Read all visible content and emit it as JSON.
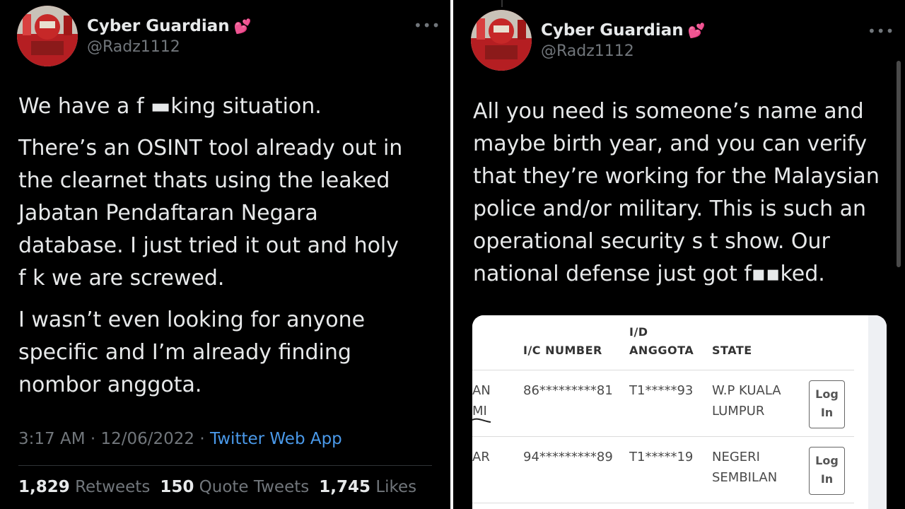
{
  "left": {
    "author": {
      "name": "Cyber Guardian",
      "emoji": "💕",
      "handle": "@Radz1112"
    },
    "more": "•••",
    "paragraphs": [
      [
        "We have a f ▬king situation."
      ],
      [
        "There’s an OSINT tool already out in",
        "the clearnet thats using the leaked",
        "Jabatan Pendaftaran Negara",
        "database. I just tried it out and holy",
        "f     k we are screwed."
      ],
      [
        "I wasn’t even looking for anyone",
        "specific and I’m already finding",
        "nombor anggota."
      ]
    ],
    "meta": {
      "time": "3:17 AM",
      "dot": " · ",
      "date": "12/06/2022",
      "app": "Twitter Web App"
    },
    "stats": {
      "retweets_count": "1,829",
      "retweets_label": "Retweets",
      "quotes_count": "150",
      "quotes_label": "Quote Tweets",
      "likes_count": "1,745",
      "likes_label": "Likes"
    }
  },
  "right": {
    "author": {
      "name": "Cyber Guardian",
      "emoji": "💕",
      "handle": "@Radz1112"
    },
    "more": "•••",
    "lines": [
      "All you need is someone’s name and",
      "maybe birth year, and you can verify",
      "that they’re working for the Malaysian",
      "police and/or military. This is such an",
      "operational security s     t show. Our",
      "national defense just got f▪▪ked."
    ],
    "table": {
      "headers": {
        "ic": "I/C NUMBER",
        "id_top": "I/D",
        "id_bottom": "ANGGOTA",
        "state": "STATE"
      },
      "rows": [
        {
          "name_top": "AN",
          "name_bottom": "MI",
          "ic": "86*********81",
          "id": "T1*****93",
          "state_top": "W.P KUALA",
          "state_bottom": "LUMPUR",
          "btn_top": "Log",
          "btn_bottom": "In"
        },
        {
          "name_top": "AR",
          "name_bottom": "",
          "ic": "94*********89",
          "id": "T1*****19",
          "state_top": "NEGERI",
          "state_bottom": "SEMBILAN",
          "btn_top": "Log",
          "btn_bottom": "In"
        }
      ]
    }
  }
}
